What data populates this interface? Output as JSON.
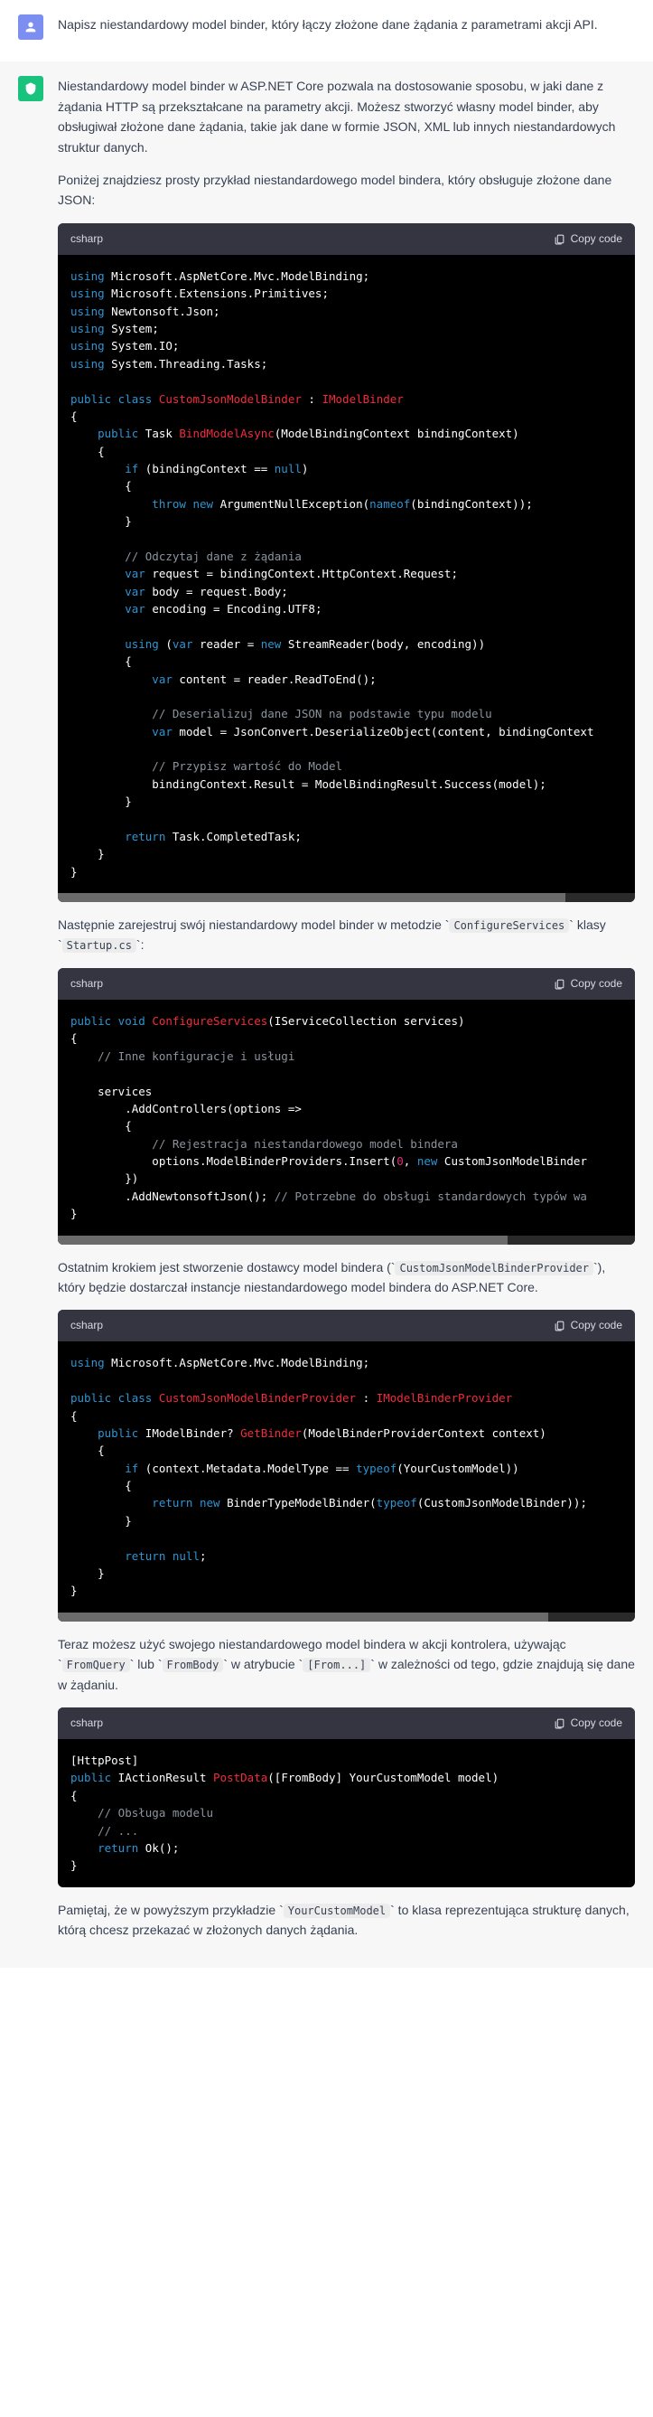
{
  "user": {
    "text": "Napisz niestandardowy model binder, który łączy złożone dane żądania z parametrami akcji API."
  },
  "assistant": {
    "p1": "Niestandardowy model binder w ASP.NET Core pozwala na dostosowanie sposobu, w jaki dane z żądania HTTP są przekształcane na parametry akcji. Możesz stworzyć własny model binder, aby obsługiwał złożone dane żądania, takie jak dane w formie JSON, XML lub innych niestandardowych struktur danych.",
    "p2": "Poniżej znajdziesz prosty przykład niestandardowego model bindera, który obsługuje złożone dane JSON:",
    "p3a": "Następnie zarejestruj swój niestandardowy model binder w metodzie ",
    "p3c1": "ConfigureServices",
    "p3b": " klasy ",
    "p3c2": "Startup.cs",
    "p3c": ":",
    "p4a": "Ostatnim krokiem jest stworzenie dostawcy model bindera (",
    "p4c1": "CustomJsonModelBinderProvider",
    "p4b": "), który będzie dostarczał instancje niestandardowego model bindera do ASP.NET Core.",
    "p5a": "Teraz możesz użyć swojego niestandardowego model bindera w akcji kontrolera, używając ",
    "p5c1": "FromQuery",
    "p5b": " lub ",
    "p5c2": "FromBody",
    "p5c": " w atrybucie ",
    "p5c3": "[From...]",
    "p5d": " w zależności od tego, gdzie znajdują się dane w żądaniu.",
    "p6a": "Pamiętaj, że w powyższym przykładzie ",
    "p6c1": "YourCustomModel",
    "p6b": " to klasa reprezentująca strukturę danych, którą chcesz przekazać w złożonych danych żądania."
  },
  "code": {
    "lang": "csharp",
    "copy": "Copy code"
  },
  "block1": {
    "l1": "using",
    "l1b": " Microsoft.AspNetCore.Mvc.ModelBinding;",
    "l2": "using",
    "l2b": " Microsoft.Extensions.Primitives;",
    "l3": "using",
    "l3b": " Newtonsoft.Json;",
    "l4": "using",
    "l4b": " System;",
    "l5": "using",
    "l5b": " System.IO;",
    "l6": "using",
    "l6b": " System.Threading.Tasks;",
    "l8a": "public",
    "l8b": " class",
    "l8c": " CustomJsonModelBinder",
    "l8d": " : ",
    "l8e": "IModelBinder",
    "l10a": "    public",
    "l10b": " Task ",
    "l10c": "BindModelAsync",
    "l10d": "(ModelBindingContext bindingContext)",
    "l12a": "        if",
    "l12b": " (bindingContext == ",
    "l12c": "null",
    "l12d": ")",
    "l14a": "            throw",
    "l14b": " new",
    "l14c": " ArgumentNullException(",
    "l14d": "nameof",
    "l14e": "(bindingContext));",
    "l17": "        // Odczytaj dane z żądania",
    "l18a": "        var",
    "l18b": " request = bindingContext.HttpContext.Request;",
    "l19a": "        var",
    "l19b": " body = request.Body;",
    "l20a": "        var",
    "l20b": " encoding = Encoding.UTF8;",
    "l22a": "        using",
    "l22b": " (",
    "l22c": "var",
    "l22d": " reader = ",
    "l22e": "new",
    "l22f": " StreamReader(body, encoding))",
    "l24a": "            var",
    "l24b": " content = reader.ReadToEnd();",
    "l26": "            // Deserializuj dane JSON na podstawie typu modelu",
    "l27a": "            var",
    "l27b": " model = JsonConvert.DeserializeObject(content, bindingContext",
    "l29": "            // Przypisz wartość do Model",
    "l30": "            bindingContext.Result = ModelBindingResult.Success(model);",
    "l33a": "        return",
    "l33b": " Task.CompletedTask;"
  },
  "block2": {
    "l1a": "public",
    "l1b": " void",
    "l1c": " ConfigureServices",
    "l1d": "(IServiceCollection services)",
    "l3": "    // Inne konfiguracje i usługi",
    "l5": "    services",
    "l6": "        .AddControllers(options =>",
    "l8": "            // Rejestracja niestandardowego model bindera",
    "l9a": "            options.ModelBinderProviders.Insert(",
    "l9b": "0",
    "l9c": ", ",
    "l9d": "new",
    "l9e": " CustomJsonModelBinder",
    "l11a": "        .AddNewtonsoftJson(); ",
    "l11b": "// Potrzebne do obsługi standardowych typów wa"
  },
  "block3": {
    "l1a": "using",
    "l1b": " Microsoft.AspNetCore.Mvc.ModelBinding;",
    "l3a": "public",
    "l3b": " class",
    "l3c": " CustomJsonModelBinderProvider",
    "l3d": " : ",
    "l3e": "IModelBinderProvider",
    "l5a": "    public",
    "l5b": " IModelBinder? ",
    "l5c": "GetBinder",
    "l5d": "(ModelBinderProviderContext context)",
    "l7a": "        if",
    "l7b": " (context.Metadata.ModelType == ",
    "l7c": "typeof",
    "l7d": "(YourCustomModel))",
    "l9a": "            return",
    "l9b": " new",
    "l9c": " BinderTypeModelBinder(",
    "l9d": "typeof",
    "l9e": "(CustomJsonModelBinder));",
    "l12a": "        return",
    "l12b": " null",
    "l12c": ";"
  },
  "block4": {
    "l1": "[HttpPost]",
    "l2a": "public",
    "l2b": " IActionResult ",
    "l2c": "PostData",
    "l2d": "([FromBody] YourCustomModel model)",
    "l4": "    // Obsługa modelu",
    "l5": "    // ...",
    "l6a": "    return",
    "l6b": " Ok();"
  }
}
